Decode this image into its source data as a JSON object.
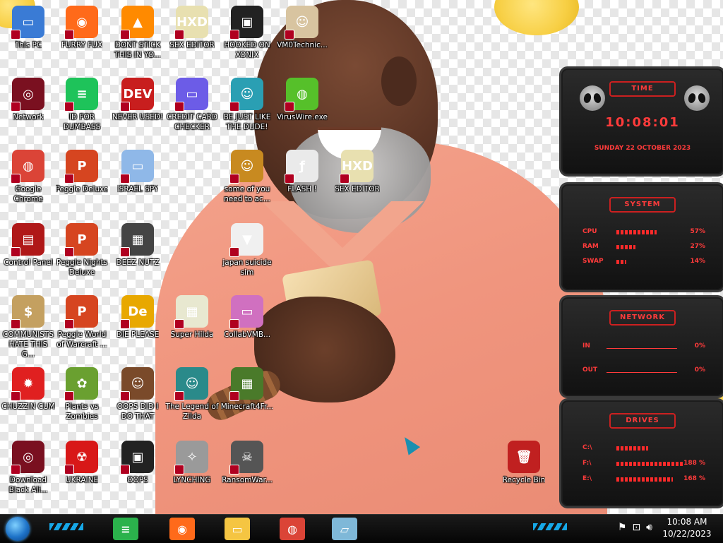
{
  "desktop_icons": [
    {
      "label": "This PC",
      "color": "#3a7bd5",
      "glyph": "▭"
    },
    {
      "label": "FURRY FUX",
      "color": "#ff6a1a",
      "glyph": "◉"
    },
    {
      "label": "DONT STICK THIS IN YO...",
      "color": "#ff8a00",
      "glyph": "▲"
    },
    {
      "label": "SEX EDITOR",
      "color": "#e8e0b0",
      "glyph": "HXD"
    },
    {
      "label": "HOOKED ON XONIX",
      "color": "#222222",
      "glyph": "▣"
    },
    {
      "label": "VM0Technic...",
      "color": "#d8c4a0",
      "glyph": "☺"
    },
    {
      "label": "Network",
      "color": "#7a1020",
      "glyph": "◎"
    },
    {
      "label": "ID FOR DUMBASS",
      "color": "#1ec35a",
      "glyph": "≡"
    },
    {
      "label": "NEVER USED!",
      "color": "#c81e1e",
      "glyph": "DEV"
    },
    {
      "label": "CREDIT CARD CHECKER",
      "color": "#6c5ce7",
      "glyph": "▭"
    },
    {
      "label": "BE JUST LIKE THE DUDE!",
      "color": "#2a9fb3",
      "glyph": "☺"
    },
    {
      "label": "VirusWire.exe",
      "color": "#56c02a",
      "glyph": "◍"
    },
    {
      "label": "Google Chrome",
      "color": "#db4437",
      "glyph": "◍"
    },
    {
      "label": "Peggle Deluxe",
      "color": "#d64520",
      "glyph": "P"
    },
    {
      "label": "ISRAEL SPY",
      "color": "#8fb8e8",
      "glyph": "▭"
    },
    {
      "label": "some of you need to ac...",
      "color": "#c88a20",
      "glyph": "☺"
    },
    {
      "label": "FLASH !",
      "color": "#eaeaea",
      "glyph": "ƒ"
    },
    {
      "label": "SEX EDITOR",
      "color": "#e8e0b0",
      "glyph": "HXD"
    },
    {
      "label": "Control Panel",
      "color": "#b01818",
      "glyph": "▤"
    },
    {
      "label": "Peggle Nights Deluxe",
      "color": "#d64520",
      "glyph": "P"
    },
    {
      "label": "DEEZ NUTZ",
      "color": "#444444",
      "glyph": "▦"
    },
    {
      "label": "japan suicide sim",
      "color": "#f0f0f0",
      "glyph": "▼"
    },
    {
      "label": "COMMUNISTS HATE THIS G...",
      "color": "#c4a060",
      "glyph": "$"
    },
    {
      "label": "Peggle World of Warcraft ...",
      "color": "#d64520",
      "glyph": "P"
    },
    {
      "label": "DIE PLEASE",
      "color": "#e8a800",
      "glyph": "De"
    },
    {
      "label": "Super Hilda",
      "color": "#e8e8d0",
      "glyph": "▦"
    },
    {
      "label": "CollabVMB...",
      "color": "#d070c0",
      "glyph": "▭"
    },
    {
      "label": "CHUZZIN CUM",
      "color": "#e02020",
      "glyph": "✹"
    },
    {
      "label": "Plants vs Zombies",
      "color": "#6aa030",
      "glyph": "✿"
    },
    {
      "label": "OOPS DID I DO THAT",
      "color": "#7a4a2a",
      "glyph": "☺"
    },
    {
      "label": "The Legend of Zilda",
      "color": "#2a8a8a",
      "glyph": "☺"
    },
    {
      "label": "Minecraft4Fr...",
      "color": "#4a7a2a",
      "glyph": "▦"
    },
    {
      "label": "Download Black Ali...",
      "color": "#7a1020",
      "glyph": "◎"
    },
    {
      "label": "UKRAINE",
      "color": "#d81818",
      "glyph": "☢"
    },
    {
      "label": "OOPS",
      "color": "#222222",
      "glyph": "▣"
    },
    {
      "label": "LYNCHING",
      "color": "#9a9a9a",
      "glyph": "✧"
    },
    {
      "label": "RansomWar...",
      "color": "#555555",
      "glyph": "☠"
    },
    {
      "label": "Recycle Bin",
      "color": "#c02020",
      "glyph": "🗑"
    }
  ],
  "gadget": {
    "time": {
      "title": "TIME",
      "clock": "10:08:01",
      "date": "SUNDAY 22 OCTOBER 2023"
    },
    "system": {
      "title": "SYSTEM",
      "rows": [
        {
          "label": "CPU",
          "value": "57%",
          "fill": 0.57
        },
        {
          "label": "RAM",
          "value": "27%",
          "fill": 0.27
        },
        {
          "label": "SWAP",
          "value": "14%",
          "fill": 0.14
        }
      ]
    },
    "network": {
      "title": "NETWORK",
      "rows": [
        {
          "label": "IN",
          "value": "0%"
        },
        {
          "label": "OUT",
          "value": "0%"
        }
      ]
    },
    "drives": {
      "title": "DRIVES",
      "rows": [
        {
          "label": "C:\\",
          "value": "",
          "fill": 0.45
        },
        {
          "label": "F:\\",
          "value": "188 %",
          "fill": 0.95
        },
        {
          "label": "E:\\",
          "value": "168 %",
          "fill": 0.8
        }
      ]
    }
  },
  "taskbar": {
    "apps": [
      {
        "name": "feedly",
        "color": "#2bb24c",
        "glyph": "≡"
      },
      {
        "name": "firefox",
        "color": "#ff6a1a",
        "glyph": "◉"
      },
      {
        "name": "file-explorer",
        "color": "#f5c542",
        "glyph": "▭"
      },
      {
        "name": "chrome",
        "color": "#db4437",
        "glyph": "◍"
      },
      {
        "name": "virtualbox",
        "color": "#7fb8d8",
        "glyph": "▱"
      }
    ],
    "tray_icons": [
      "flag-icon",
      "network-icon",
      "volume-icon"
    ],
    "time": "10:08 AM",
    "date": "10/22/2023"
  },
  "colors": {
    "gadget_red": "#ff3b3b",
    "taskbar_accent": "#17b8ff"
  }
}
